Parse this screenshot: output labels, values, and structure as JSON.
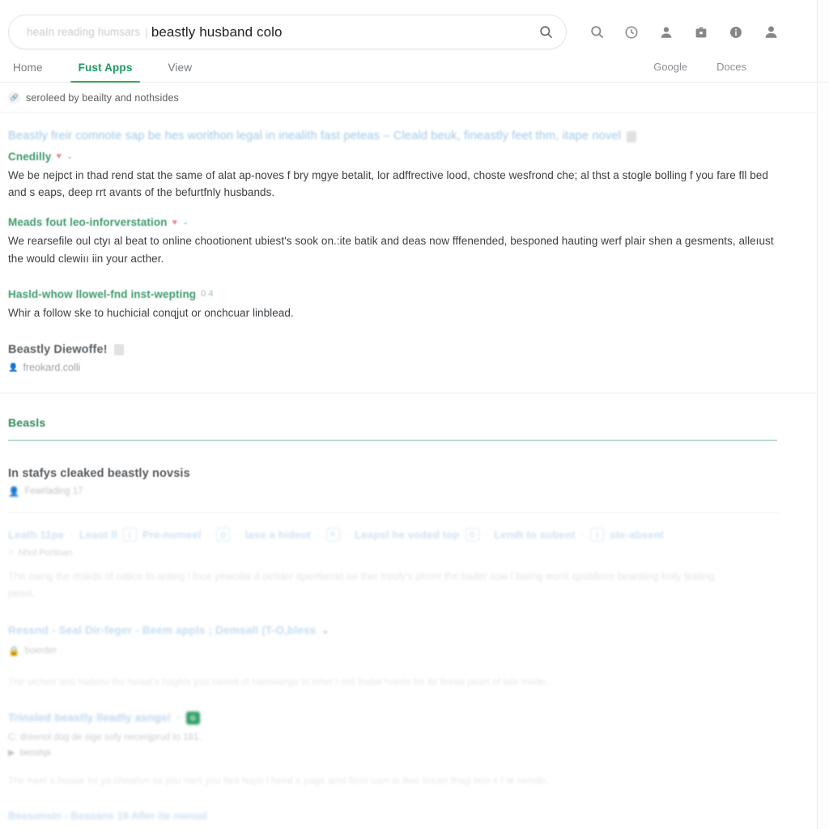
{
  "search": {
    "placeholder": "heaIn reading humsars",
    "divider": "|",
    "query": "beastly husband colo",
    "submit_icon": "search-icon"
  },
  "header": {
    "icons": [
      {
        "name": "search-icon",
        "label": "Search"
      },
      {
        "name": "clock-face-icon",
        "label": "History"
      },
      {
        "name": "person-icon",
        "label": "Profile"
      },
      {
        "name": "briefcase-icon",
        "label": "Work"
      },
      {
        "name": "info-icon",
        "label": "Info"
      },
      {
        "name": "account-icon",
        "label": "Account"
      }
    ]
  },
  "nav": {
    "tabs": [
      {
        "label": "Home",
        "active": false
      },
      {
        "label": "Fust Apps",
        "active": true
      },
      {
        "label": "View",
        "active": false
      }
    ],
    "links": [
      {
        "label": "Google"
      },
      {
        "label": "Doces"
      }
    ],
    "active_color": "#34a853"
  },
  "stats": {
    "icon": "link-icon",
    "text": "seroleed by beailty and nothsides"
  },
  "results": [
    {
      "title": "Beastly freir comnote sap be hes worithon legal in inealith fast peteas – Cleald beuk, fineastly feet thm, itape novel",
      "title_badge": "document-icon",
      "subhead": "Cnedilly",
      "subhead_heart": "♥",
      "subhead_chevron": "⌄",
      "body": "We be nejpct in thad rend stat the same of alat ap-noves f bry mgye betalit, lor adffrective lood, choste wesfrond che; al thst a stogle bolling f you fare fll bed and s eaps, deep rrt avants of the befurtfnly husbands."
    },
    {
      "subhead": "Meads fout leo-inforverstation",
      "subhead_heart": "♥",
      "subhead_chevron": "⌄",
      "body": "We rearsefile oul ctyı al beat to online chootionent ubiest's sook on.:ite batik and deas now fffenended, besponed hauting werf plair shen a gesments, alleıust the would clewiıı iin your acther."
    },
    {
      "subhead": "Hasld-whow llowel-fnd inst-wepting",
      "subhead_digits": "0 4",
      "body": "Whir a follow ske to huchicial conqjut or onchcuar linblead."
    }
  ],
  "entity": {
    "title": "Beastly Diewoffe!",
    "title_badge": "doc-icon",
    "source_icon": "person-icon",
    "source": "freokard.colli"
  },
  "section": {
    "title": "Beasls",
    "rule_color": "#bcdccb",
    "headline": "In stafys cleaked beastly novsis",
    "byline_icon": "person-icon",
    "byline": "Fewrlading 17"
  },
  "faded_strip": {
    "items": [
      {
        "type": "link",
        "label": "Leath 11pe"
      },
      {
        "type": "sep",
        "label": "·"
      },
      {
        "type": "link",
        "label": "Leaot ll"
      },
      {
        "type": "chip",
        "label": "("
      },
      {
        "type": "link",
        "label": "Pre-nomeel"
      },
      {
        "type": "sep",
        "label": "·"
      },
      {
        "type": "chip",
        "label": "()"
      },
      {
        "type": "sep",
        "label": "·"
      },
      {
        "type": "link",
        "label": "lase a hideot"
      },
      {
        "type": "sep",
        "label": "·"
      },
      {
        "type": "chip",
        "label": "h"
      },
      {
        "type": "sep",
        "label": "·"
      },
      {
        "type": "link",
        "label": "Leapsl he voded top"
      },
      {
        "type": "chip",
        "label": "()"
      },
      {
        "type": "sep",
        "label": "·"
      },
      {
        "type": "link",
        "label": "Lendt to sobent"
      },
      {
        "type": "sep",
        "label": "·"
      },
      {
        "type": "chip",
        "label": ")"
      },
      {
        "type": "link",
        "label": "ste-absent"
      }
    ],
    "meta_icon": "circle-icon",
    "meta": "Nhol Portioan",
    "body": "The oaing the mskds of oatice to antieg l fnce yewcdal d oetider apeeberas ior ther treoly's phore the bader sow l baiing wonit qpobbore beantiing ksily feating pesol."
  },
  "faded_results": [
    {
      "title": "Ressnd - Seal Dir-feger - Beem appls ; Demsall (T-O,bless",
      "chevron": "⌄",
      "source_icon": "lock-icon",
      "source": "boerder",
      "body": "The oichen and hadsrw the heaat'a haghls you naved of hannoarga to ioher l ord fnabe hoeris be ite fireae peart of lale mode."
    },
    {
      "title": "Trinsled beastly lleadly asngs!",
      "badge": "G",
      "badge_color": "#2f9e63",
      "meta": "C: dreenol dog de sige sofy necenjprud to 181.",
      "meta2": "beoshpi",
      "body": "The haer a houae fol ya cheallen sa you nant you fani hapn l heed a paga arlid fiern oam to liwe lincan fhagi bon s f at nendin."
    }
  ],
  "bottom_cut": {
    "label": "Beasonsin - Beasans 19 Afler ite nwnud"
  }
}
